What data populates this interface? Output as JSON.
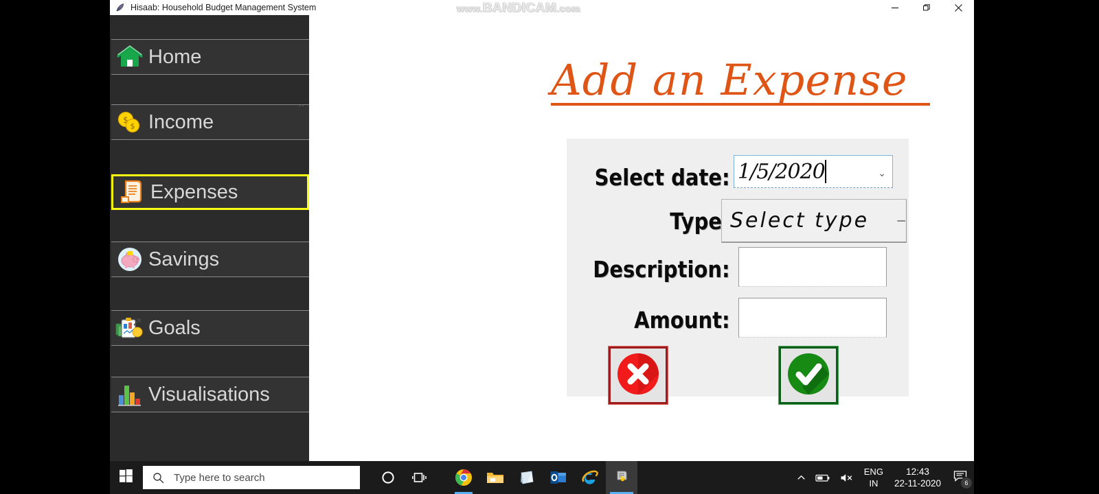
{
  "window": {
    "title": "Hisaab: Household Budget Management System",
    "icon": "feather-pen-icon",
    "controls": {
      "minimize": "—",
      "restore": "❐",
      "close": "✕"
    }
  },
  "watermark": {
    "prefix": "www.",
    "brand": "BANDICAM",
    "suffix": ".com"
  },
  "sidebar": {
    "items": [
      {
        "label": "Home",
        "icon": "house-icon",
        "selected": false
      },
      {
        "label": "Income",
        "icon": "coins-icon",
        "selected": false
      },
      {
        "label": "Expenses",
        "icon": "receipt-scroll-icon",
        "selected": true
      },
      {
        "label": "Savings",
        "icon": "piggy-bank-icon",
        "selected": false
      },
      {
        "label": "Goals",
        "icon": "goals-clipboard-icon",
        "selected": false
      },
      {
        "label": "Visualisations",
        "icon": "bar-chart-icon",
        "selected": false
      }
    ]
  },
  "main": {
    "page_title": "Add an Expense",
    "form": {
      "date": {
        "label": "Select date:",
        "value": "1/5/2020",
        "chevron": "⌄"
      },
      "type": {
        "label": "Type:",
        "value": "Select type",
        "arrow": "–"
      },
      "description": {
        "label": "Description:",
        "value": ""
      },
      "amount": {
        "label": "Amount:",
        "value": ""
      },
      "cancel_button": {
        "name": "cancel",
        "icon": "red-circle-x-icon"
      },
      "confirm_button": {
        "name": "confirm",
        "icon": "green-circle-check-icon"
      }
    }
  },
  "taskbar": {
    "start": "windows-logo-icon",
    "search_placeholder": "Type here to search",
    "cortana": "cortana-circle-icon",
    "task_view": "task-view-icon",
    "apps": [
      {
        "name": "chrome-icon",
        "running": true
      },
      {
        "name": "file-explorer-icon",
        "running": false
      },
      {
        "name": "sticky-notes-icon",
        "running": false
      },
      {
        "name": "outlook-icon",
        "running": false
      },
      {
        "name": "internet-explorer-icon",
        "running": false
      },
      {
        "name": "python-app-icon",
        "running": true,
        "active": true
      }
    ],
    "tray": {
      "chevron": "⌃",
      "battery": "battery-icon",
      "volume": "volume-muted-icon",
      "lang_top": "ENG",
      "lang_bottom": "IN",
      "time": "12:43",
      "date": "22-11-2020",
      "notification_badge": "6"
    }
  },
  "colors": {
    "accent_orange": "#df5516",
    "select_yellow": "#ffff14",
    "sidebar_bg": "#333333",
    "panel_bg": "#efefef",
    "taskbar_bg": "#1b1b1b"
  }
}
